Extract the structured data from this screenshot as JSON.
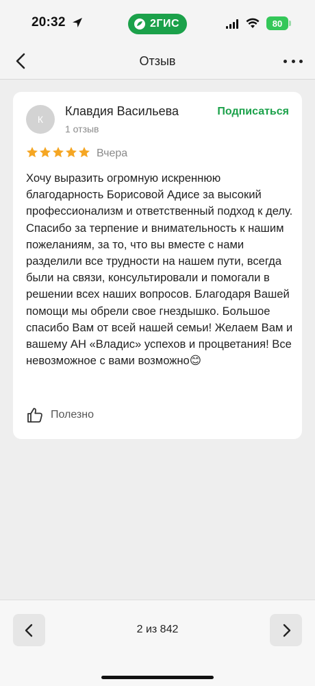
{
  "status_bar": {
    "time": "20:32",
    "app_brand": "2ГИС",
    "battery": "80"
  },
  "nav": {
    "title": "Отзыв"
  },
  "review": {
    "avatar_initial": "К",
    "author_name": "Клавдия Васильева",
    "author_reviews": "1 отзыв",
    "subscribe_label": "Подписаться",
    "rating": 5,
    "rating_max": 5,
    "date": "Вчера",
    "text": "Хочу выразить огромную искреннюю благодарность Борисовой Адисе за высокий профессионализм и ответственный подход к делу. Спасибо за терпение и внимательность к нашим пожеланиям, за то, что вы вместе с нами разделили все трудности на нашем пути, всегда были на связи, консультировали и помогали в решении всех наших вопросов. Благодаря Вашей помощи мы обрели свое гнездышко. Большое спасибо Вам от всей нашей семьи! Желаем Вам и вашему АН «Владис» успехов и процветания! Все невозможное с вами возможно😊",
    "useful_label": "Полезно"
  },
  "pager": {
    "label": "2 из 842"
  },
  "colors": {
    "accent_green": "#1ba14a",
    "star_yellow": "#f5a623",
    "battery_green": "#34c759"
  },
  "icons": {
    "back": "chevron-left-icon",
    "more": "more-dots-icon",
    "useful": "thumbs-up-icon",
    "prev": "chevron-left-icon",
    "next": "chevron-right-icon"
  }
}
